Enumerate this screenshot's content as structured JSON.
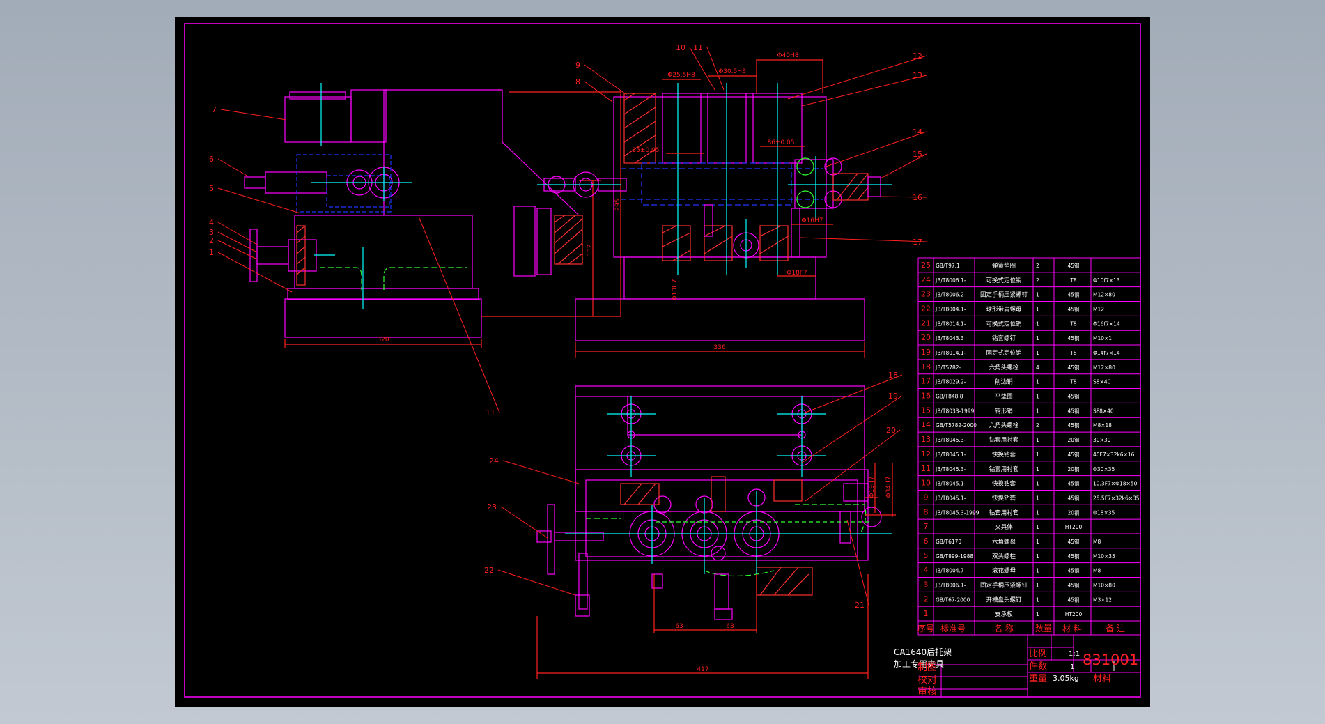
{
  "colors": {
    "background": "#b4bcc6",
    "paper": "#000000",
    "outline": "#ff00ff",
    "centerline": "#00ffff",
    "hidden": "#2233ff",
    "leader": "#ff2020",
    "dimension": "#ff2020",
    "hatch": "#ff3030",
    "subassembly": "#33ff33",
    "detail": "#ffffff"
  },
  "balloons": {
    "left_view": [
      "7",
      "6",
      "5",
      "4",
      "3",
      "2",
      "1",
      "11"
    ],
    "front_view": [
      "9",
      "8",
      "10",
      "11",
      "12",
      "13",
      "14",
      "15",
      "16",
      "17"
    ],
    "top_view": [
      "18",
      "19",
      "20",
      "24",
      "23",
      "22",
      "21"
    ]
  },
  "dimensions": {
    "left_view": {
      "width": "320",
      "overall_height": "295",
      "base_height": "132"
    },
    "front_view": {
      "width": "336",
      "bore_a": "Φ25.5H8",
      "bore_b": "Φ30.5H8",
      "bore_c": "Φ40H8",
      "top_c": "35±0.05",
      "mid_c": "86±0.05",
      "dia_16": "Φ16H7",
      "dia_18": "Φ18F7",
      "dia_10": "Φ10H7"
    },
    "top_view": {
      "width": "417",
      "pitch_1": "63",
      "pitch_2": "63",
      "offset_1": "Φ19H7",
      "offset_2": "Φ34H7"
    }
  },
  "bom": {
    "rows": [
      {
        "no": "25",
        "std": "GB/T97.1",
        "name": "弹簧垫圈",
        "qty": "2",
        "mat": "45钢",
        "note": ""
      },
      {
        "no": "24",
        "std": "JB/T8006.1-",
        "name": "可换式定位销",
        "qty": "2",
        "mat": "T8",
        "note": "Φ10f7×13"
      },
      {
        "no": "23",
        "std": "JB/T8006.2-",
        "name": "固定手柄压紧螺钉",
        "qty": "1",
        "mat": "45钢",
        "note": "M12×80"
      },
      {
        "no": "22",
        "std": "JB/T8004.1-",
        "name": "球形带肩螺母",
        "qty": "1",
        "mat": "45钢",
        "note": "M12"
      },
      {
        "no": "21",
        "std": "JB/T8014.1-",
        "name": "可换式定位销",
        "qty": "1",
        "mat": "T8",
        "note": "Φ16f7×14"
      },
      {
        "no": "20",
        "std": "JB/T8043.3",
        "name": "钻套螺钉",
        "qty": "1",
        "mat": "45钢",
        "note": "M10×1"
      },
      {
        "no": "19",
        "std": "JB/T8014.1-",
        "name": "固定式定位销",
        "qty": "1",
        "mat": "T8",
        "note": "Φ14f7×14"
      },
      {
        "no": "18",
        "std": "JB/T5782-",
        "name": "六角头螺栓",
        "qty": "4",
        "mat": "45钢",
        "note": "M12×80"
      },
      {
        "no": "17",
        "std": "JB/T8029.2-",
        "name": "削边销",
        "qty": "1",
        "mat": "T8",
        "note": "S8×40"
      },
      {
        "no": "16",
        "std": "GB/T848.8",
        "name": "平垫圈",
        "qty": "1",
        "mat": "45钢",
        "note": ""
      },
      {
        "no": "15",
        "std": "JB/T8033-1999",
        "name": "钩形销",
        "qty": "1",
        "mat": "45钢",
        "note": "SF8×40"
      },
      {
        "no": "14",
        "std": "GB/T5782-2000",
        "name": "六角头螺栓",
        "qty": "2",
        "mat": "45钢",
        "note": "M8×18"
      },
      {
        "no": "13",
        "std": "JB/T8045.3-",
        "name": "钻套用衬套",
        "qty": "1",
        "mat": "20钢",
        "note": "30×30"
      },
      {
        "no": "12",
        "std": "JB/T8045.1-",
        "name": "快换钻套",
        "qty": "1",
        "mat": "45钢",
        "note": "40F7×32k6×16"
      },
      {
        "no": "11",
        "std": "JB/T8045.3-",
        "name": "钻套用衬套",
        "qty": "1",
        "mat": "20钢",
        "note": "Φ30×35"
      },
      {
        "no": "10",
        "std": "JB/T8045.1-",
        "name": "快换钻套",
        "qty": "1",
        "mat": "45钢",
        "note": "10.3F7×Φ18×50"
      },
      {
        "no": "9",
        "std": "JB/T8045.1-",
        "name": "快换钻套",
        "qty": "1",
        "mat": "45钢",
        "note": "25.5F7×32k6×35"
      },
      {
        "no": "8",
        "std": "JB/T8045.3-1999",
        "name": "钻套用衬套",
        "qty": "1",
        "mat": "20钢",
        "note": "Φ18×35"
      },
      {
        "no": "7",
        "std": "",
        "name": "夹具体",
        "qty": "1",
        "mat": "HT200",
        "note": ""
      },
      {
        "no": "6",
        "std": "GB/T6170",
        "name": "六角螺母",
        "qty": "1",
        "mat": "45钢",
        "note": "M8"
      },
      {
        "no": "5",
        "std": "GB/T899-1988",
        "name": "双头螺柱",
        "qty": "1",
        "mat": "45钢",
        "note": "M10×35"
      },
      {
        "no": "4",
        "std": "JB/T8004.7",
        "name": "滚花螺母",
        "qty": "1",
        "mat": "45钢",
        "note": "M8"
      },
      {
        "no": "3",
        "std": "JB/T8006.1-",
        "name": "固定手柄压紧螺钉",
        "qty": "1",
        "mat": "45钢",
        "note": "M10×80"
      },
      {
        "no": "2",
        "std": "GB/T67-2000",
        "name": "开槽盘头螺钉",
        "qty": "1",
        "mat": "45钢",
        "note": "M3×12"
      },
      {
        "no": "1",
        "std": "",
        "name": "支承板",
        "qty": "1",
        "mat": "HT200",
        "note": ""
      }
    ],
    "header": {
      "no": "序号",
      "std": "标准号",
      "name": "名 称",
      "qty": "数量",
      "mat": "材 料",
      "note": "备 注"
    }
  },
  "title_block": {
    "title_line1": "CA1640后托架",
    "title_line2": "加工专用夹具",
    "scale_label": "比例",
    "scale_value": "1:1",
    "count_label": "件数",
    "count_value": "1",
    "weight_label": "重量",
    "weight_value": "3.05kg",
    "material_label": "材料",
    "drawing_no": "831001",
    "drawn_by": "制图",
    "checked_by": "校对",
    "reviewed_by": "审核"
  }
}
